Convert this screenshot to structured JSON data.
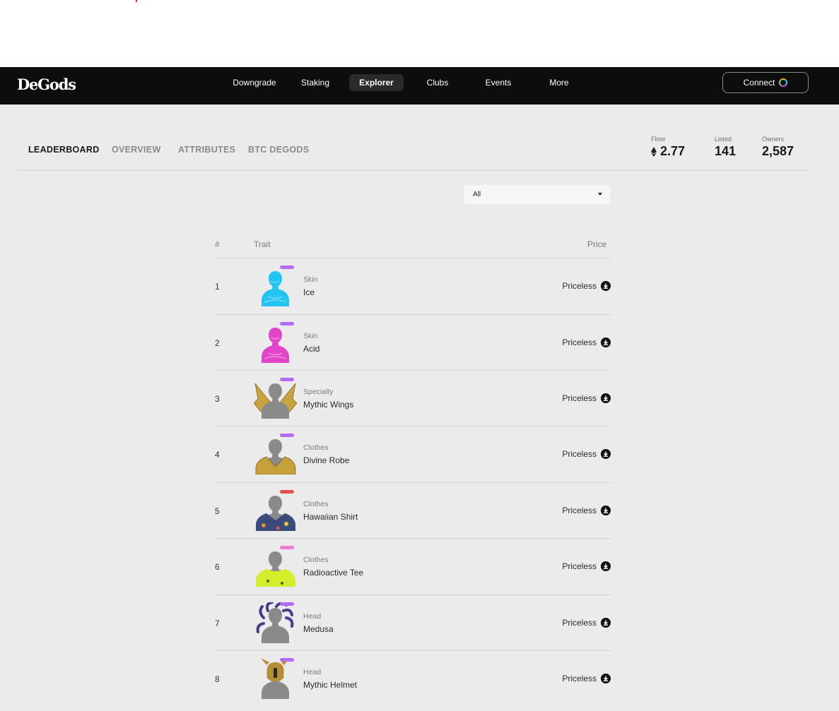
{
  "brand": {
    "logo": "DeGods"
  },
  "nav": {
    "items": [
      {
        "label": "Downgrade",
        "active": false
      },
      {
        "label": "Staking",
        "active": false
      },
      {
        "label": "Explorer",
        "active": true
      },
      {
        "label": "Clubs",
        "active": false
      },
      {
        "label": "Events",
        "active": false
      },
      {
        "label": "More",
        "active": false
      }
    ],
    "connect_label": "Connect"
  },
  "tabs": [
    {
      "label": "LEADERBOARD",
      "active": true
    },
    {
      "label": "OVERVIEW",
      "active": false
    },
    {
      "label": "ATTRIBUTES",
      "active": false
    },
    {
      "label": "BTC DEGODS",
      "active": false
    }
  ],
  "stats": {
    "floor": {
      "label": "Floor",
      "value": "2.77",
      "icon": "eth-icon"
    },
    "listed": {
      "label": "Listed",
      "value": "141"
    },
    "owners": {
      "label": "Owners",
      "value": "2,587"
    }
  },
  "filter": {
    "selected": "All"
  },
  "table": {
    "headers": {
      "rank": "#",
      "trait": "Trait",
      "price": "Price"
    },
    "rows": [
      {
        "rank": "1",
        "category": "Skin",
        "name": "Ice",
        "price": "Priceless",
        "badge_color": "#b06cf0",
        "art_color": "#22c4f2",
        "art": "skin"
      },
      {
        "rank": "2",
        "category": "Skin",
        "name": "Acid",
        "price": "Priceless",
        "badge_color": "#b06cf0",
        "art_color": "#e246c8",
        "art": "skin"
      },
      {
        "rank": "3",
        "category": "Specialty",
        "name": "Mythic Wings",
        "price": "Priceless",
        "badge_color": "#b06cf0",
        "art_color": "#c9a33e",
        "art": "wings"
      },
      {
        "rank": "4",
        "category": "Clothes",
        "name": "Divine Robe",
        "price": "Priceless",
        "badge_color": "#b06cf0",
        "art_color": "#c6a038",
        "art": "robe"
      },
      {
        "rank": "5",
        "category": "Clothes",
        "name": "Hawaiian Shirt",
        "price": "Priceless",
        "badge_color": "#e0524a",
        "art_color": "#3a4a7a",
        "art": "shirt"
      },
      {
        "rank": "6",
        "category": "Clothes",
        "name": "Radioactive Tee",
        "price": "Priceless",
        "badge_color": "#f07ad8",
        "art_color": "#d4ee2c",
        "art": "tee"
      },
      {
        "rank": "7",
        "category": "Head",
        "name": "Medusa",
        "price": "Priceless",
        "badge_color": "#b06cf0",
        "art_color": "#4b3c8a",
        "art": "medusa"
      },
      {
        "rank": "8",
        "category": "Head",
        "name": "Mythic Helmet",
        "price": "Priceless",
        "badge_color": "#b06cf0",
        "art_color": "#b58d35",
        "art": "helmet"
      }
    ]
  }
}
